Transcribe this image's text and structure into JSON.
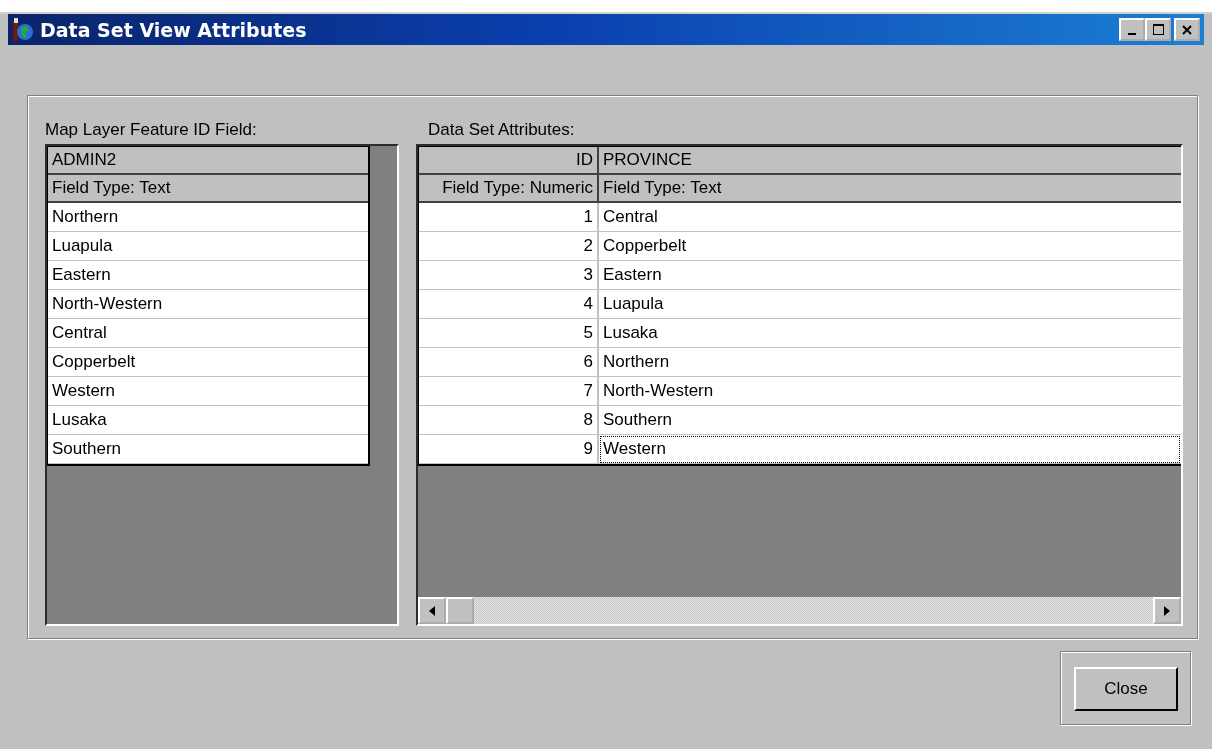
{
  "window": {
    "title": "Data Set View Attributes"
  },
  "left": {
    "label": "Map Layer Feature ID Field:",
    "header": "ADMIN2",
    "field_type": "Field Type: Text",
    "rows": [
      "Northern",
      "Luapula",
      "Eastern",
      "North-Western",
      "Central",
      "Copperbelt",
      "Western",
      "Lusaka",
      "Southern"
    ]
  },
  "right": {
    "label": "Data Set Attributes:",
    "columns": [
      {
        "header": "ID",
        "field_type": "Field Type: Numeric"
      },
      {
        "header": "PROVINCE",
        "field_type": "Field Type: Text"
      }
    ],
    "rows": [
      {
        "cells": [
          "1",
          "Central"
        ],
        "focused": false
      },
      {
        "cells": [
          "2",
          "Copperbelt"
        ],
        "focused": false
      },
      {
        "cells": [
          "3",
          "Eastern"
        ],
        "focused": false
      },
      {
        "cells": [
          "4",
          "Luapula"
        ],
        "focused": false
      },
      {
        "cells": [
          "5",
          "Lusaka"
        ],
        "focused": false
      },
      {
        "cells": [
          "6",
          "Northern"
        ],
        "focused": false
      },
      {
        "cells": [
          "7",
          "North-Western"
        ],
        "focused": false
      },
      {
        "cells": [
          "8",
          "Southern"
        ],
        "focused": false
      },
      {
        "cells": [
          "9",
          "Western"
        ],
        "focused": true
      }
    ]
  },
  "buttons": [
    "Close"
  ]
}
